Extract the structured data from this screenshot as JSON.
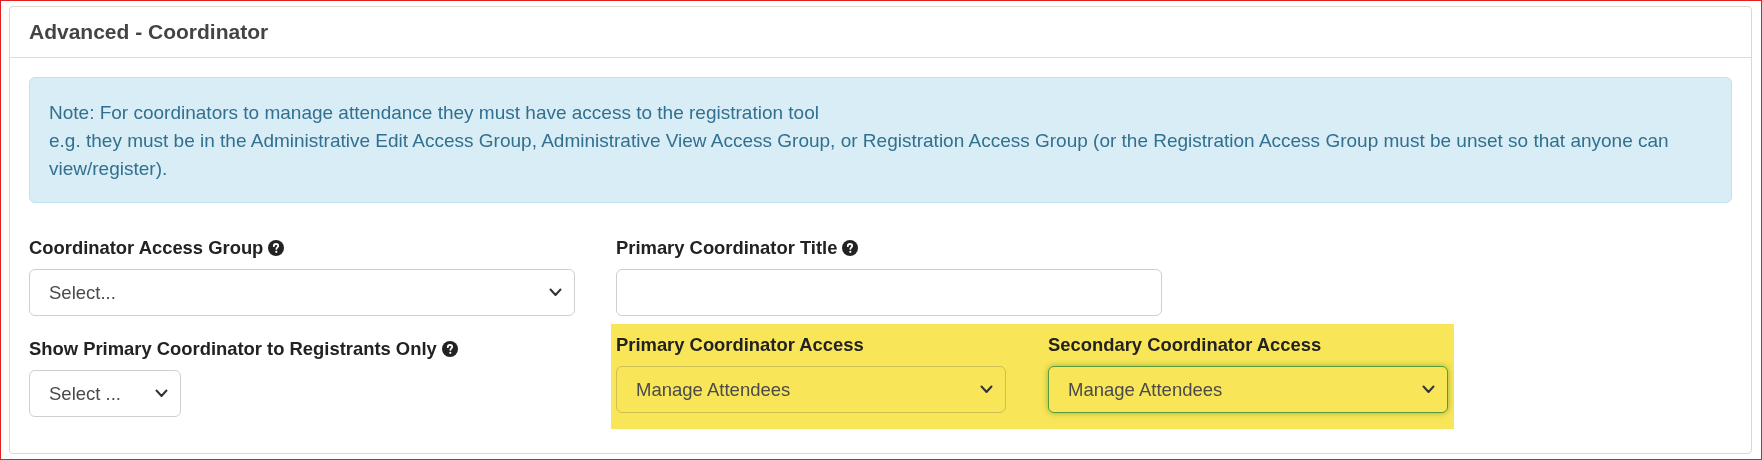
{
  "panel": {
    "title": "Advanced - Coordinator"
  },
  "note": {
    "lines": [
      "Note: For coordinators to manage attendance they must have access to the registration tool",
      "e.g. they must be in the Administrative Edit Access Group, Administrative View Access Group, or Registration Access Group (or the Registration Access Group must be unset so that anyone can view/register)."
    ]
  },
  "fields": [
    {
      "kind": "select",
      "label": "Coordinator Access Group",
      "help": true,
      "value": "Select...",
      "highlighted": false,
      "focused": false
    },
    {
      "kind": "text",
      "label": "Primary Coordinator Title",
      "help": true,
      "highlighted": false,
      "focused": false
    },
    {
      "kind": "select",
      "label": "Show Primary Coordinator to Registrants Only",
      "help": true,
      "value": "Select ...",
      "highlighted": false,
      "focused": false
    },
    {
      "kind": "select",
      "label": "Primary Coordinator Access",
      "help": false,
      "value": "Manage Attendees",
      "highlighted": true,
      "focused": false
    },
    {
      "kind": "select",
      "label": "Secondary Coordinator Access",
      "help": false,
      "value": "Manage Attendees",
      "highlighted": true,
      "focused": true
    }
  ]
}
